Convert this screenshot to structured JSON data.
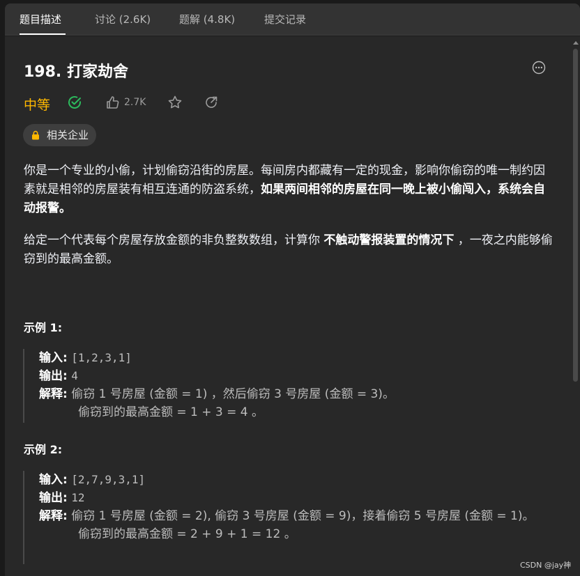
{
  "tabs": [
    {
      "label": "题目描述",
      "active": true
    },
    {
      "label": "讨论 (2.6K)",
      "active": false
    },
    {
      "label": "题解 (4.8K)",
      "active": false
    },
    {
      "label": "提交记录",
      "active": false
    }
  ],
  "problem": {
    "title": "198. 打家劫舍",
    "difficulty": "中等",
    "likes": "2.7K",
    "company_tag": "相关企业"
  },
  "description": {
    "p1_part1": "你是一个专业的小偷，计划偷窃沿街的房屋。每间房内都藏有一定的现金，影响你偷窃的唯一制约因素就是相邻的房屋装有相互连通的防盗系统，",
    "p1_bold": "如果两间相邻的房屋在同一晚上被小偷闯入，系统会自动报警",
    "p1_end": "。",
    "p2_part1": "给定一个代表每个房屋存放金额的非负整数数组，计算你 ",
    "p2_bold": "不触动警报装置的情况下",
    "p2_part2": " ，一夜之内能够偷窃到的最高金额。"
  },
  "examples": [
    {
      "title": "示例 1:",
      "input_label": "输入:",
      "input": "[1,2,3,1]",
      "output_label": "输出:",
      "output": "4",
      "explain_label": "解释:",
      "explain_line1": "偷窃 1 号房屋 (金额 = 1) ，然后偷窃 3 号房屋 (金额 = 3)。",
      "explain_line2": "偷窃到的最高金额 = 1 + 3 = 4 。"
    },
    {
      "title": "示例 2:",
      "input_label": "输入:",
      "input": "[2,7,9,3,1]",
      "output_label": "输出:",
      "output": "12",
      "explain_label": "解释:",
      "explain_line1": "偷窃 1 号房屋 (金额 = 2), 偷窃 3 号房屋 (金额 = 9)，接着偷窃 5 号房屋 (金额 = 1)。",
      "explain_line2": "偷窃到的最高金额 = 2 + 9 + 1 = 12 。"
    }
  ],
  "watermark": "CSDN @jay神",
  "colors": {
    "difficulty_medium": "#ffb800",
    "accepted_check": "#2cbb5d",
    "background": "#282828"
  },
  "icons": {
    "more": "more-horizontal-icon",
    "accepted": "check-circle-icon",
    "like": "thumbs-up-icon",
    "favorite": "star-icon",
    "share": "share-icon",
    "lock": "lock-icon"
  }
}
